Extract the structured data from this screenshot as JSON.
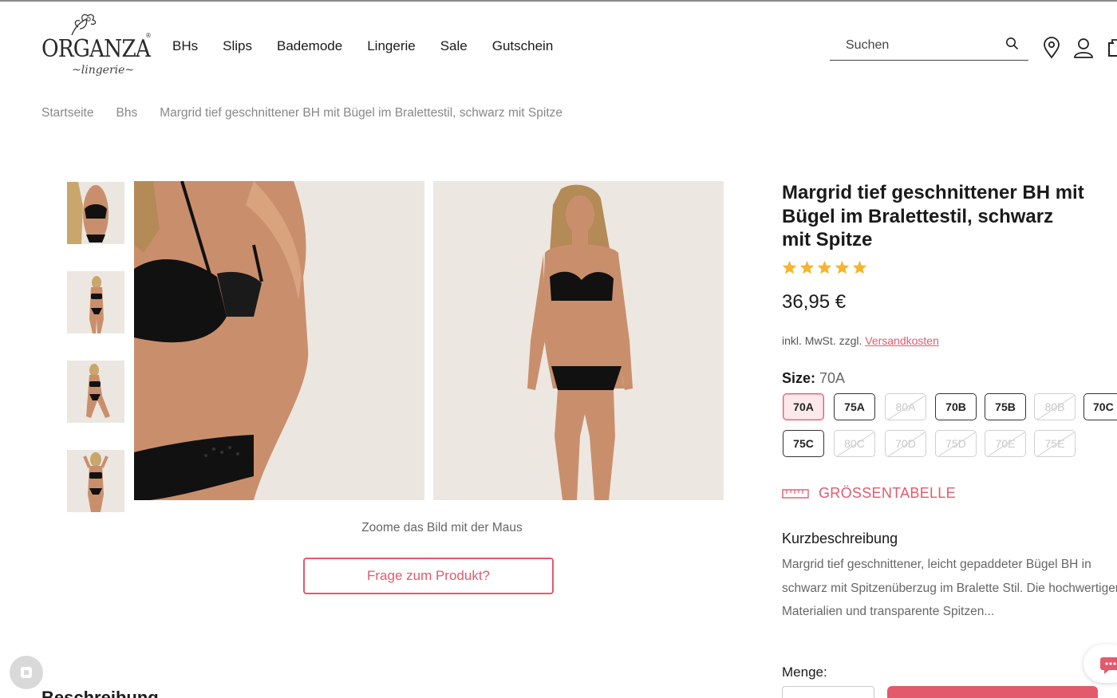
{
  "brand": {
    "name": "ORGANZA",
    "tagline": "lingerie",
    "registered": "®"
  },
  "nav": [
    {
      "label": "BHs"
    },
    {
      "label": "Slips"
    },
    {
      "label": "Bademode"
    },
    {
      "label": "Lingerie"
    },
    {
      "label": "Sale"
    },
    {
      "label": "Gutschein"
    }
  ],
  "search": {
    "placeholder": "Suchen",
    "icon": "search-icon"
  },
  "header_icons": [
    "location-pin-icon",
    "user-icon",
    "cart-icon"
  ],
  "breadcrumb": [
    {
      "label": "Startseite"
    },
    {
      "label": "Bhs"
    },
    {
      "label": "Margrid tief geschnittener BH mit Bügel im Bralettestil, schwarz mit Spitze"
    }
  ],
  "gallery": {
    "thumbnails": 4,
    "zoom_hint": "Zoome das Bild mit der Maus",
    "ask_button": "Frage zum Produkt?"
  },
  "product": {
    "title": "Margrid tief geschnittener BH mit Bügel im Bralettestil, schwarz mit Spitze",
    "rating": 5,
    "price": "36,95 €",
    "tax_prefix": "inkl. MwSt. zzgl.",
    "shipping_link": "Versandkosten",
    "size_label": "Size:",
    "selected_size": "70A",
    "sizes": [
      {
        "label": "70A",
        "state": "active"
      },
      {
        "label": "75A",
        "state": "available"
      },
      {
        "label": "80A",
        "state": "unavailable"
      },
      {
        "label": "70B",
        "state": "available"
      },
      {
        "label": "75B",
        "state": "available"
      },
      {
        "label": "80B",
        "state": "unavailable"
      },
      {
        "label": "70C",
        "state": "available"
      },
      {
        "label": "75C",
        "state": "available"
      },
      {
        "label": "80C",
        "state": "unavailable"
      },
      {
        "label": "70D",
        "state": "unavailable"
      },
      {
        "label": "75D",
        "state": "unavailable"
      },
      {
        "label": "70E",
        "state": "unavailable"
      },
      {
        "label": "75E",
        "state": "unavailable"
      }
    ],
    "size_table": "GRÖSSENTABELLE",
    "short_desc_title": "Kurzbeschreibung",
    "short_desc_lines": [
      "Margrid tief geschnittener, leicht gepaddeter Bügel BH in",
      "schwarz mit Spitzenüberzug im Bralette Stil. Die hochwertigen",
      "Materialien und transparente Spitzen..."
    ],
    "quantity_label": "Menge:"
  },
  "description_heading": "Beschreibung",
  "colors": {
    "accent": "#e25a6c",
    "star": "#f5b52e",
    "active_bg": "#fde9ec"
  }
}
